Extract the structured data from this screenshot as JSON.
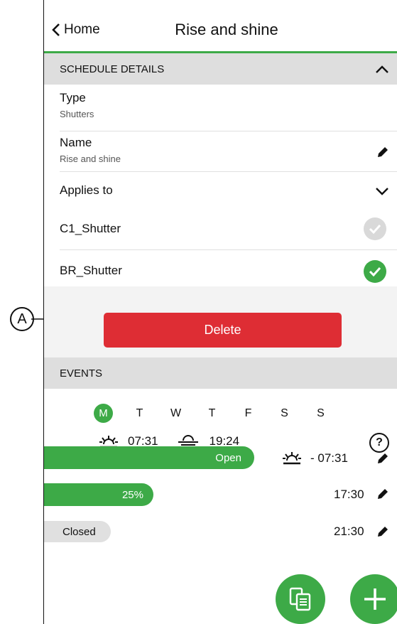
{
  "header": {
    "back_label": "Home",
    "title": "Rise and shine"
  },
  "schedule": {
    "section_label": "SCHEDULE DETAILS",
    "type_label": "Type",
    "type_value": "Shutters",
    "name_label": "Name",
    "name_value": "Rise and shine",
    "applies_label": "Applies to",
    "devices": [
      {
        "name": "C1_Shutter",
        "selected": false
      },
      {
        "name": "BR_Shutter",
        "selected": true
      }
    ]
  },
  "delete_label": "Delete",
  "callout_label": "A",
  "events": {
    "section_label": "EVENTS",
    "days": [
      "M",
      "T",
      "W",
      "T",
      "F",
      "S",
      "S"
    ],
    "active_day": "M",
    "sunrise_time": "07:31",
    "sunset_time": "19:24",
    "help_label": "?",
    "list": [
      {
        "state": "Open",
        "level_percent": 100,
        "time": "- 07:31",
        "icon": "sunrise-icon"
      },
      {
        "state": "25%",
        "level_percent": 25,
        "time": "17:30",
        "icon": ""
      },
      {
        "state": "Closed",
        "level_percent": 0,
        "time": "21:30",
        "icon": ""
      }
    ]
  },
  "colors": {
    "accent": "#3daa47",
    "danger": "#de2d34",
    "section_bg": "#dedede"
  },
  "fab": {
    "copy_icon": "copy-icon",
    "add_icon": "plus-icon"
  }
}
